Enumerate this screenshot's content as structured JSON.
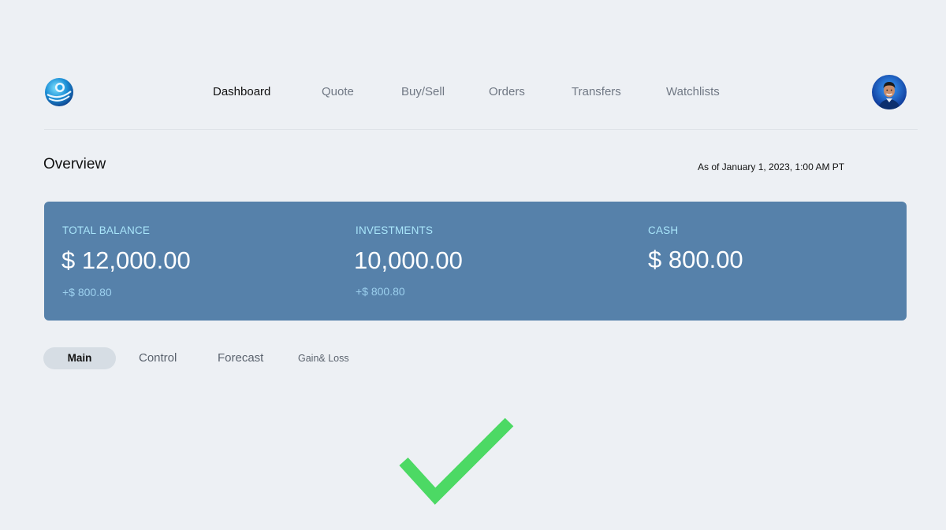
{
  "header": {
    "logo_icon": "globe-logo-icon",
    "avatar_icon": "user-avatar-icon",
    "nav_items": [
      {
        "label": "Dashboard",
        "active": true
      },
      {
        "label": "Quote",
        "active": false
      },
      {
        "label": "Buy/Sell",
        "active": false
      },
      {
        "label": "Orders",
        "active": false
      },
      {
        "label": "Transfers",
        "active": false
      },
      {
        "label": "Watchlists",
        "active": false
      }
    ]
  },
  "overview": {
    "title": "Overview",
    "as_of": "As of January 1, 2023, 1:00 AM PT"
  },
  "summary": {
    "total_balance": {
      "label": "TOTAL BALANCE",
      "value": "$ 12,000.00",
      "change": "+$ 800.80"
    },
    "investments": {
      "label": "INVESTMENTS",
      "value": "10,000.00",
      "change": "+$ 800.80"
    },
    "cash": {
      "label": "CASH",
      "value": "$ 800.00"
    }
  },
  "tabs": [
    {
      "label": "Main",
      "active": true
    },
    {
      "label": "Control",
      "active": false
    },
    {
      "label": "Forecast",
      "active": false
    },
    {
      "label": "Gain& Loss",
      "active": false
    }
  ],
  "overlay": {
    "icon": "green-checkmark-icon",
    "color": "#4cd964"
  },
  "colors": {
    "background": "#edf0f4",
    "card": "#5681aa",
    "card_label": "#a9e6fb"
  }
}
